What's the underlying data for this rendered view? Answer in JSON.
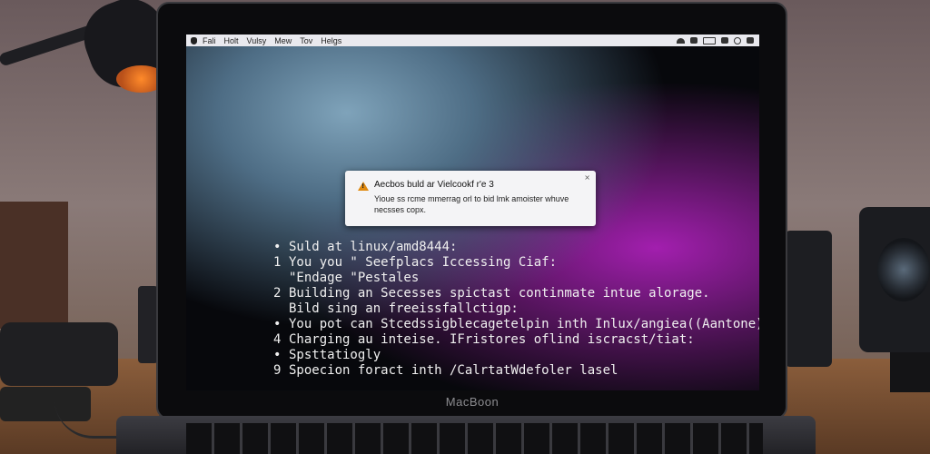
{
  "menubar": {
    "items": [
      "Fali",
      "Holt",
      "Vulsy",
      "Mew",
      "Tov",
      "Helgs"
    ]
  },
  "dialog": {
    "title": "Aecbos buld ar Vielcookf r'e 3",
    "body": "Yioue ss rcme mmerrag orl to bid lmk amoister whuve necsses copx.",
    "close": "×"
  },
  "terminal": {
    "lines": [
      {
        "mark": "•",
        "text": "Suld at linux/amd8444:"
      },
      {
        "mark": "1",
        "text": "You you \" Seefplacs Iccessing Ciaf:"
      },
      {
        "mark": "",
        "text": "\"Endage \"Pestales"
      },
      {
        "mark": "2",
        "text": "Building an Secesses spictast continmate intue alorage."
      },
      {
        "mark": "",
        "text": "Bild sing an freeissfallctigp:"
      },
      {
        "mark": "•",
        "text": "You pot can Stcedssigblecagetelpin inth Inlux/angiea((Aantone),"
      },
      {
        "mark": "4",
        "text": "Charging au inteise. IFristores oflind iscracst/tiat:"
      },
      {
        "mark": "•",
        "text": "Spsttatiogly"
      },
      {
        "mark": "9",
        "text": "Spoecion foract inth /CalrtatWdefoler lasel"
      }
    ]
  },
  "laptop": {
    "brand": "MacBoon"
  },
  "colors": {
    "dialog_bg": "#f4f4f6",
    "screen_accent": "#a21fae",
    "warning": "#e08a10"
  }
}
